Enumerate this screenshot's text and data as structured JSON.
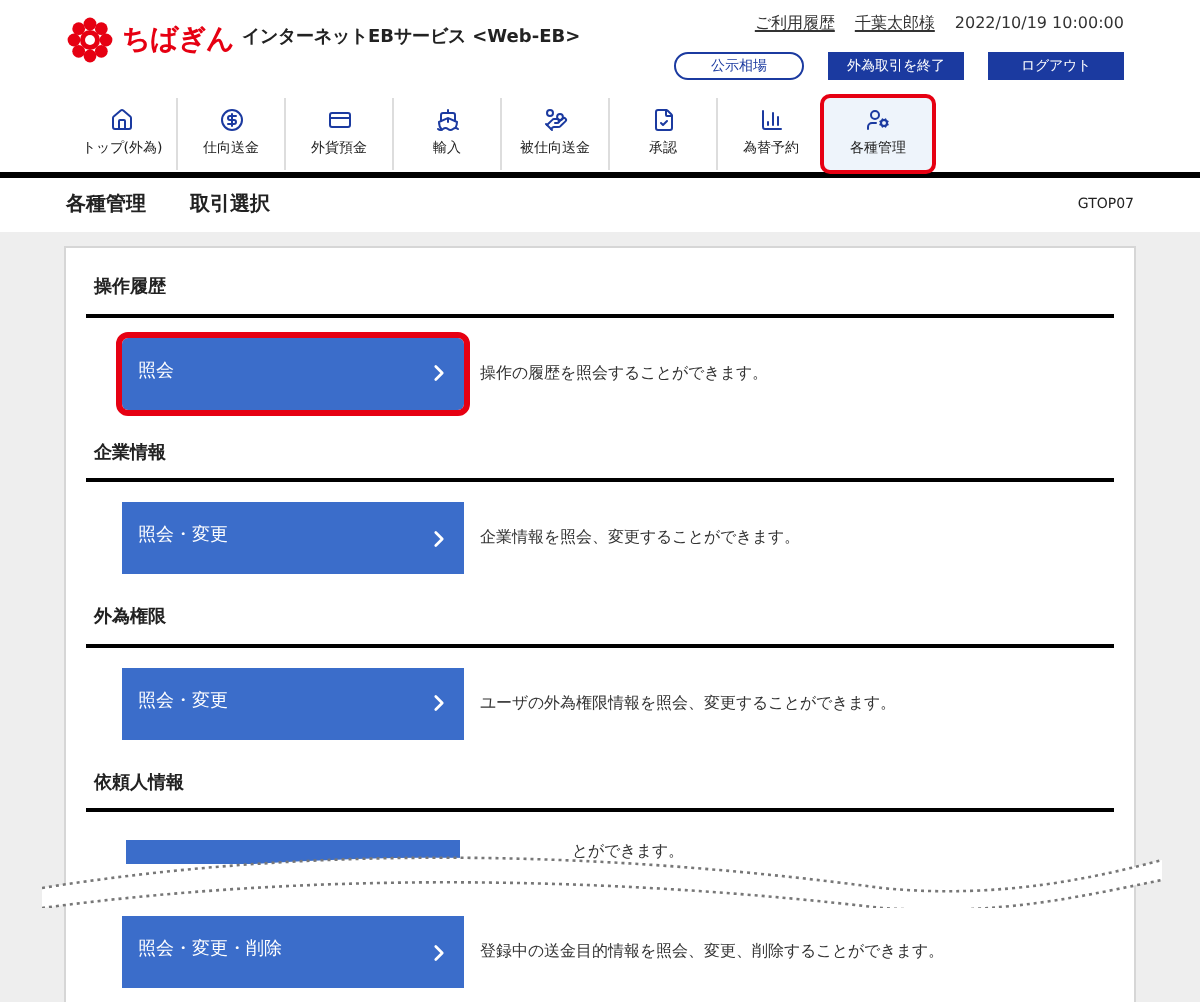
{
  "header": {
    "bank_name": "ちばぎん",
    "service_name": "インターネットEBサービス <Web-EB>",
    "usage_history_link": "ご利用履歴",
    "user_name": "千葉太郎様",
    "datetime": "2022/10/19 10:00:00",
    "buttons": [
      {
        "kind": "outline",
        "label": "公示相場"
      },
      {
        "kind": "solid",
        "label": "外為取引を終了"
      },
      {
        "kind": "solid",
        "label": "ログアウト"
      }
    ]
  },
  "nav": [
    {
      "kind": "home",
      "label": "トップ(外為)",
      "selected": false
    },
    {
      "kind": "send",
      "label": "仕向送金",
      "selected": false
    },
    {
      "kind": "deposit",
      "label": "外貨預金",
      "selected": false
    },
    {
      "kind": "import",
      "label": "輸入",
      "selected": false
    },
    {
      "kind": "receive",
      "label": "被仕向送金",
      "selected": false
    },
    {
      "kind": "approve",
      "label": "承認",
      "selected": false
    },
    {
      "kind": "forex",
      "label": "為替予約",
      "selected": false
    },
    {
      "kind": "manage",
      "label": "各種管理",
      "selected": true
    }
  ],
  "breadcrumb": {
    "title": "各種管理",
    "subtitle": "取引選択",
    "screen_id": "GTOP07"
  },
  "sections": [
    {
      "title": "操作履歴",
      "rows": [
        {
          "kind": "full",
          "button": "照会",
          "description": "操作の履歴を照会することができます。",
          "highlighted": true
        }
      ]
    },
    {
      "title": "企業情報",
      "rows": [
        {
          "kind": "full",
          "button": "照会・変更",
          "description": "企業情報を照会、変更することができます。",
          "highlighted": false
        }
      ]
    },
    {
      "title": "外為権限",
      "rows": [
        {
          "kind": "full",
          "button": "照会・変更",
          "description": "ユーザの外為権限情報を照会、変更することができます。",
          "highlighted": false
        }
      ]
    },
    {
      "title": "依頼人情報",
      "rows": [
        {
          "kind": "cut",
          "description": "とができます。"
        },
        {
          "kind": "tear"
        },
        {
          "kind": "full",
          "button": "照会・変更・削除",
          "description": "登録中の送金目的情報を照会、変更、削除することができます。",
          "highlighted": false
        }
      ]
    }
  ]
}
